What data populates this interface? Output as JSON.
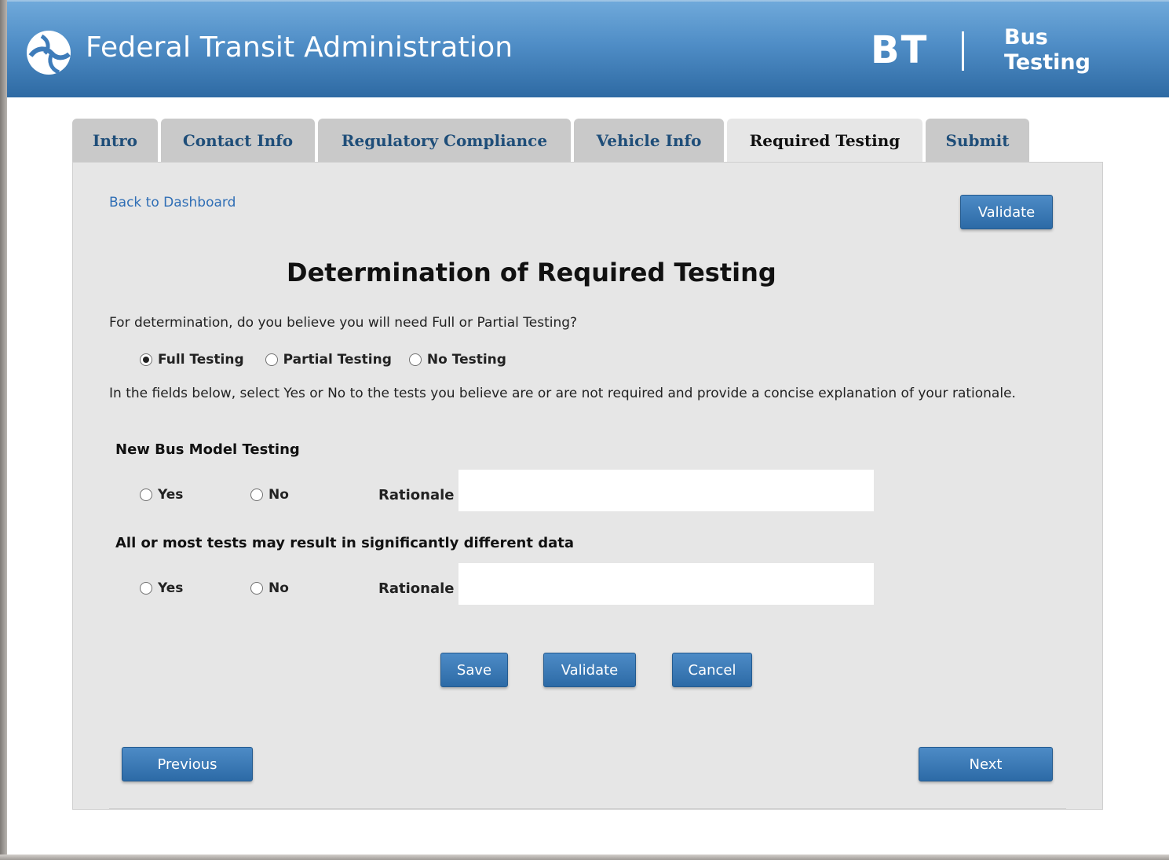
{
  "header": {
    "agency_title": "Federal Transit Administration",
    "app_abbrev": "BT",
    "app_name_line1": "Bus",
    "app_name_line2": "Testing"
  },
  "tabs": [
    {
      "label": "Intro"
    },
    {
      "label": "Contact Info"
    },
    {
      "label": "Regulatory Compliance"
    },
    {
      "label": "Vehicle Info"
    },
    {
      "label": "Required Testing",
      "active": true
    },
    {
      "label": "Submit"
    }
  ],
  "nav": {
    "back_link": "Back to Dashboard",
    "validate_top": "Validate"
  },
  "form": {
    "heading": "Determination of Required Testing",
    "question": "For determination, do you believe you will need Full or Partial Testing?",
    "testing_options": [
      {
        "label": "Full Testing",
        "checked": true
      },
      {
        "label": "Partial Testing",
        "checked": false
      },
      {
        "label": "No Testing",
        "checked": false
      }
    ],
    "instructions": "In the fields below, select Yes or No to the tests you believe are or are not required and provide a concise explanation of your rationale.",
    "sections": [
      {
        "title": "New Bus Model Testing",
        "yes_label": "Yes",
        "no_label": "No",
        "rationale_label": "Rationale",
        "rationale_value": ""
      },
      {
        "title": "All or most tests may result in significantly different data",
        "yes_label": "Yes",
        "no_label": "No",
        "rationale_label": "Rationale",
        "rationale_value": ""
      }
    ]
  },
  "actions": {
    "save": "Save",
    "validate": "Validate",
    "cancel": "Cancel",
    "previous": "Previous",
    "next": "Next"
  },
  "colors": {
    "header_top": "#6fa9da",
    "header_bottom": "#2e6aa3",
    "button": "#3a79b6",
    "tab_text": "#1f4e79",
    "link": "#2f6eb5"
  }
}
